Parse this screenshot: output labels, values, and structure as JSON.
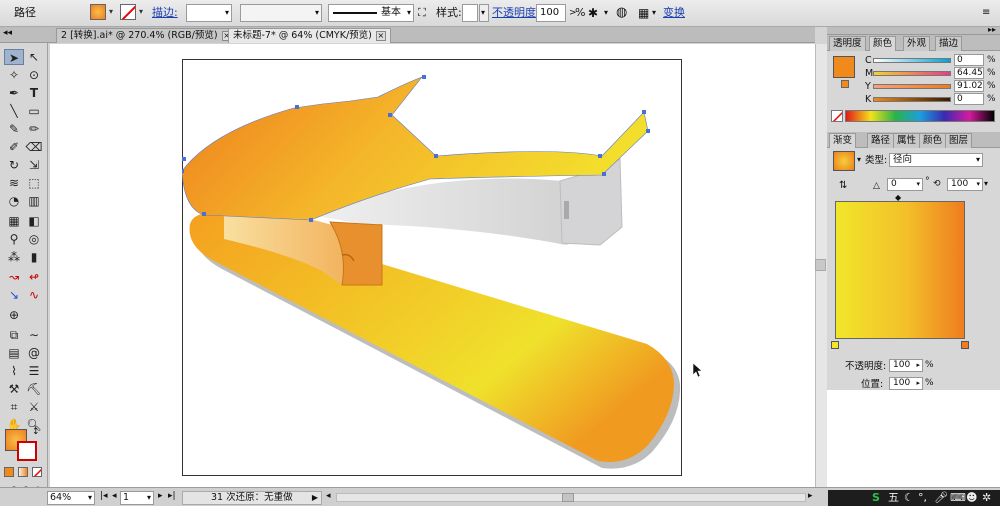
{
  "control_bar": {
    "mode_label": "路径",
    "stroke_link": "描边:",
    "stroke_weight": "",
    "stroke_profile": "基本",
    "style_label": "样式:",
    "opacity_link": "不透明度:",
    "opacity_value": "100",
    "opacity_unit": ">",
    "opacity_pct": "%",
    "transform_link": "变换",
    "fill_color": "#f08a1c"
  },
  "document_tabs": [
    {
      "label": "2 [转换].ai* @ 270.4% (RGB/预览)",
      "close": "×"
    },
    {
      "label": "未标题-7* @ 64% (CMYK/预览)",
      "close": "×"
    }
  ],
  "status_bar": {
    "zoom": "64%",
    "artboard_num": "1",
    "history": "31 次还原：无重做"
  },
  "color_panel": {
    "tabs": [
      "透明度",
      "颜色",
      "外观",
      "描边"
    ],
    "active_tab": "颜色",
    "channels": [
      {
        "name": "C",
        "value": "0"
      },
      {
        "name": "M",
        "value": "64.45"
      },
      {
        "name": "Y",
        "value": "91.02"
      },
      {
        "name": "K",
        "value": "0"
      }
    ],
    "pct": "%",
    "swatch_color": "#f08a1c"
  },
  "gradient_panel": {
    "tabs": [
      "渐变",
      "路径",
      "属性",
      "颜色",
      "图层"
    ],
    "active_tab": "渐变",
    "type_label": "类型:",
    "type_value": "径向",
    "angle_value": "0",
    "degree": "°",
    "aspect_value": "100",
    "opacity_label": "不透明度:",
    "opacity_value": "100",
    "position_label": "位置:",
    "position_value": "100",
    "pct": "%",
    "stop_start_color": "#f2e62a",
    "stop_end_color": "#ef7d1f"
  },
  "ime": {
    "logo": "S",
    "mode": "五"
  }
}
